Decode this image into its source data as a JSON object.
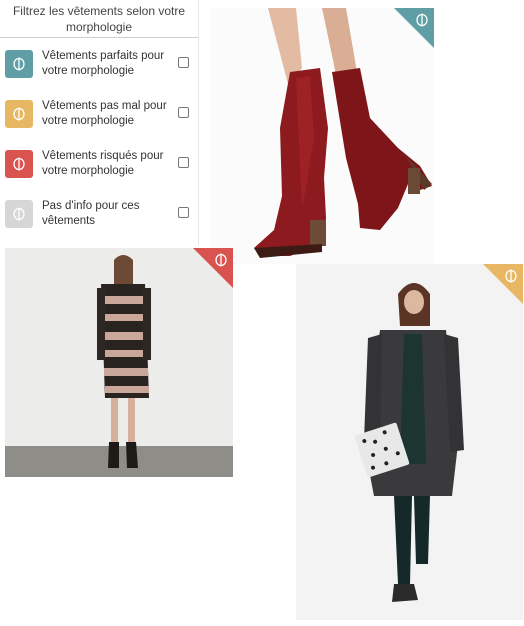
{
  "filter": {
    "title": "Filtrez les vêtements selon votre morphologie",
    "options": [
      {
        "label": "Vêtements parfaits pour votre morphologie",
        "color": "#5f9ea4",
        "icon": "morphology-phi-icon"
      },
      {
        "label": "Vêtements pas mal pour votre morphologie",
        "color": "#e7b764",
        "icon": "morphology-phi-icon"
      },
      {
        "label": "Vêtements risqués pour votre morphologie",
        "color": "#d9534f",
        "icon": "morphology-phi-icon"
      },
      {
        "label": "Pas d'info pour ces vêtements",
        "color": "#d6d6d6",
        "icon": "morphology-phi-icon"
      }
    ]
  },
  "products": [
    {
      "name": "red-knee-boots",
      "badge_color": "#5f9ea4",
      "badge_icon": "morphology-phi-icon"
    },
    {
      "name": "striped-shift-dress",
      "badge_color": "#d9534f",
      "badge_icon": "morphology-phi-icon"
    },
    {
      "name": "grey-long-coat-outfit",
      "badge_color": "#e7b764",
      "badge_icon": "morphology-phi-icon"
    }
  ]
}
